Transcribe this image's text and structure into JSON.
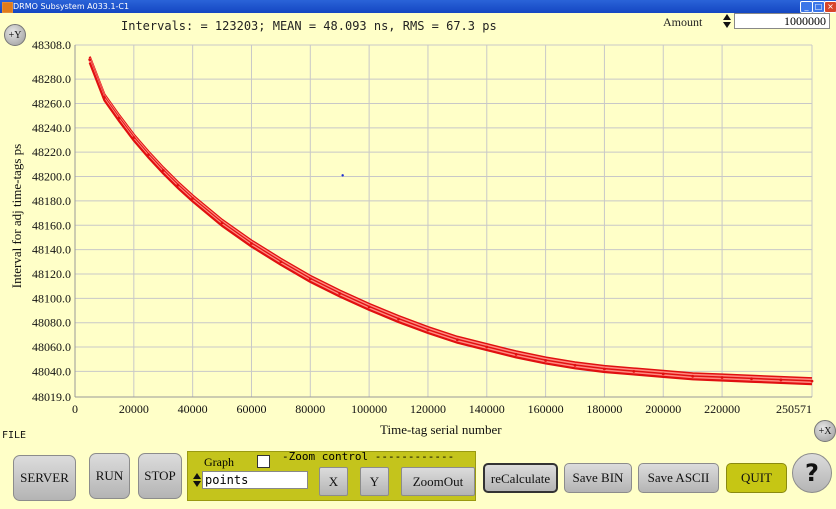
{
  "window": {
    "title": "DRMO Subsystem A033.1-C1",
    "min": "_",
    "max": "□",
    "close": "×"
  },
  "stats": "Intervals: = 123203; MEAN = 48.093 ns, RMS = 67.3 ps",
  "amount": {
    "label": "Amount",
    "value": "1000000"
  },
  "zoom_y_label": "+Y",
  "zoom_x_label": "+X",
  "file_label": "FILE",
  "chart_data": {
    "type": "scatter",
    "title": "",
    "xlabel": "Time-tag serial number",
    "ylabel": "Interval for adj time-tags ps",
    "xlim": [
      0,
      250571
    ],
    "ylim": [
      48019.0,
      48308.0
    ],
    "x_ticks": [
      "0",
      "20000",
      "40000",
      "60000",
      "80000",
      "100000",
      "120000",
      "140000",
      "160000",
      "180000",
      "200000",
      "220000",
      "250571"
    ],
    "x_tick_values": [
      0,
      20000,
      40000,
      60000,
      80000,
      100000,
      120000,
      140000,
      160000,
      180000,
      200000,
      220000,
      250571
    ],
    "y_ticks": [
      "48308.0",
      "48280.0",
      "48260.0",
      "48240.0",
      "48220.0",
      "48200.0",
      "48180.0",
      "48160.0",
      "48140.0",
      "48120.0",
      "48100.0",
      "48080.0",
      "48060.0",
      "48040.0",
      "48019.0"
    ],
    "y_tick_values": [
      48308,
      48280,
      48260,
      48240,
      48220,
      48200,
      48180,
      48160,
      48140,
      48120,
      48100,
      48080,
      48060,
      48040,
      48019
    ],
    "grid": true,
    "series": [
      {
        "color": "#e01010",
        "x": [
          5000,
          10000,
          15000,
          20000,
          25000,
          30000,
          35000,
          40000,
          50000,
          60000,
          70000,
          80000,
          90000,
          100000,
          110000,
          120000,
          130000,
          140000,
          150000,
          160000,
          170000,
          180000,
          190000,
          200000,
          210000,
          220000,
          230000,
          240000,
          250571
        ],
        "y": [
          48296,
          48265,
          48248,
          48232,
          48218,
          48205,
          48193,
          48182,
          48162,
          48145,
          48130,
          48116,
          48104,
          48093,
          48083,
          48074,
          48066,
          48060,
          48054,
          48049,
          48045,
          48042,
          48040,
          48038,
          48036,
          48035,
          48034,
          48033,
          48032
        ],
        "band_width": 6
      },
      {
        "color": "#1a2ad0",
        "x": [
          91000
        ],
        "y": [
          48201
        ]
      }
    ]
  },
  "controls": {
    "server": "SERVER",
    "run": "RUN",
    "stop": "STOP",
    "graph_label": "Graph",
    "zoom_title": "-Zoom control ------------",
    "graph_mode": "points",
    "x": "X",
    "y": "Y",
    "zoomout": "ZoomOut",
    "recalculate": "reCalculate",
    "save_bin": "Save BIN",
    "save_ascii": "Save ASCII",
    "quit": "QUIT",
    "help": "?"
  }
}
